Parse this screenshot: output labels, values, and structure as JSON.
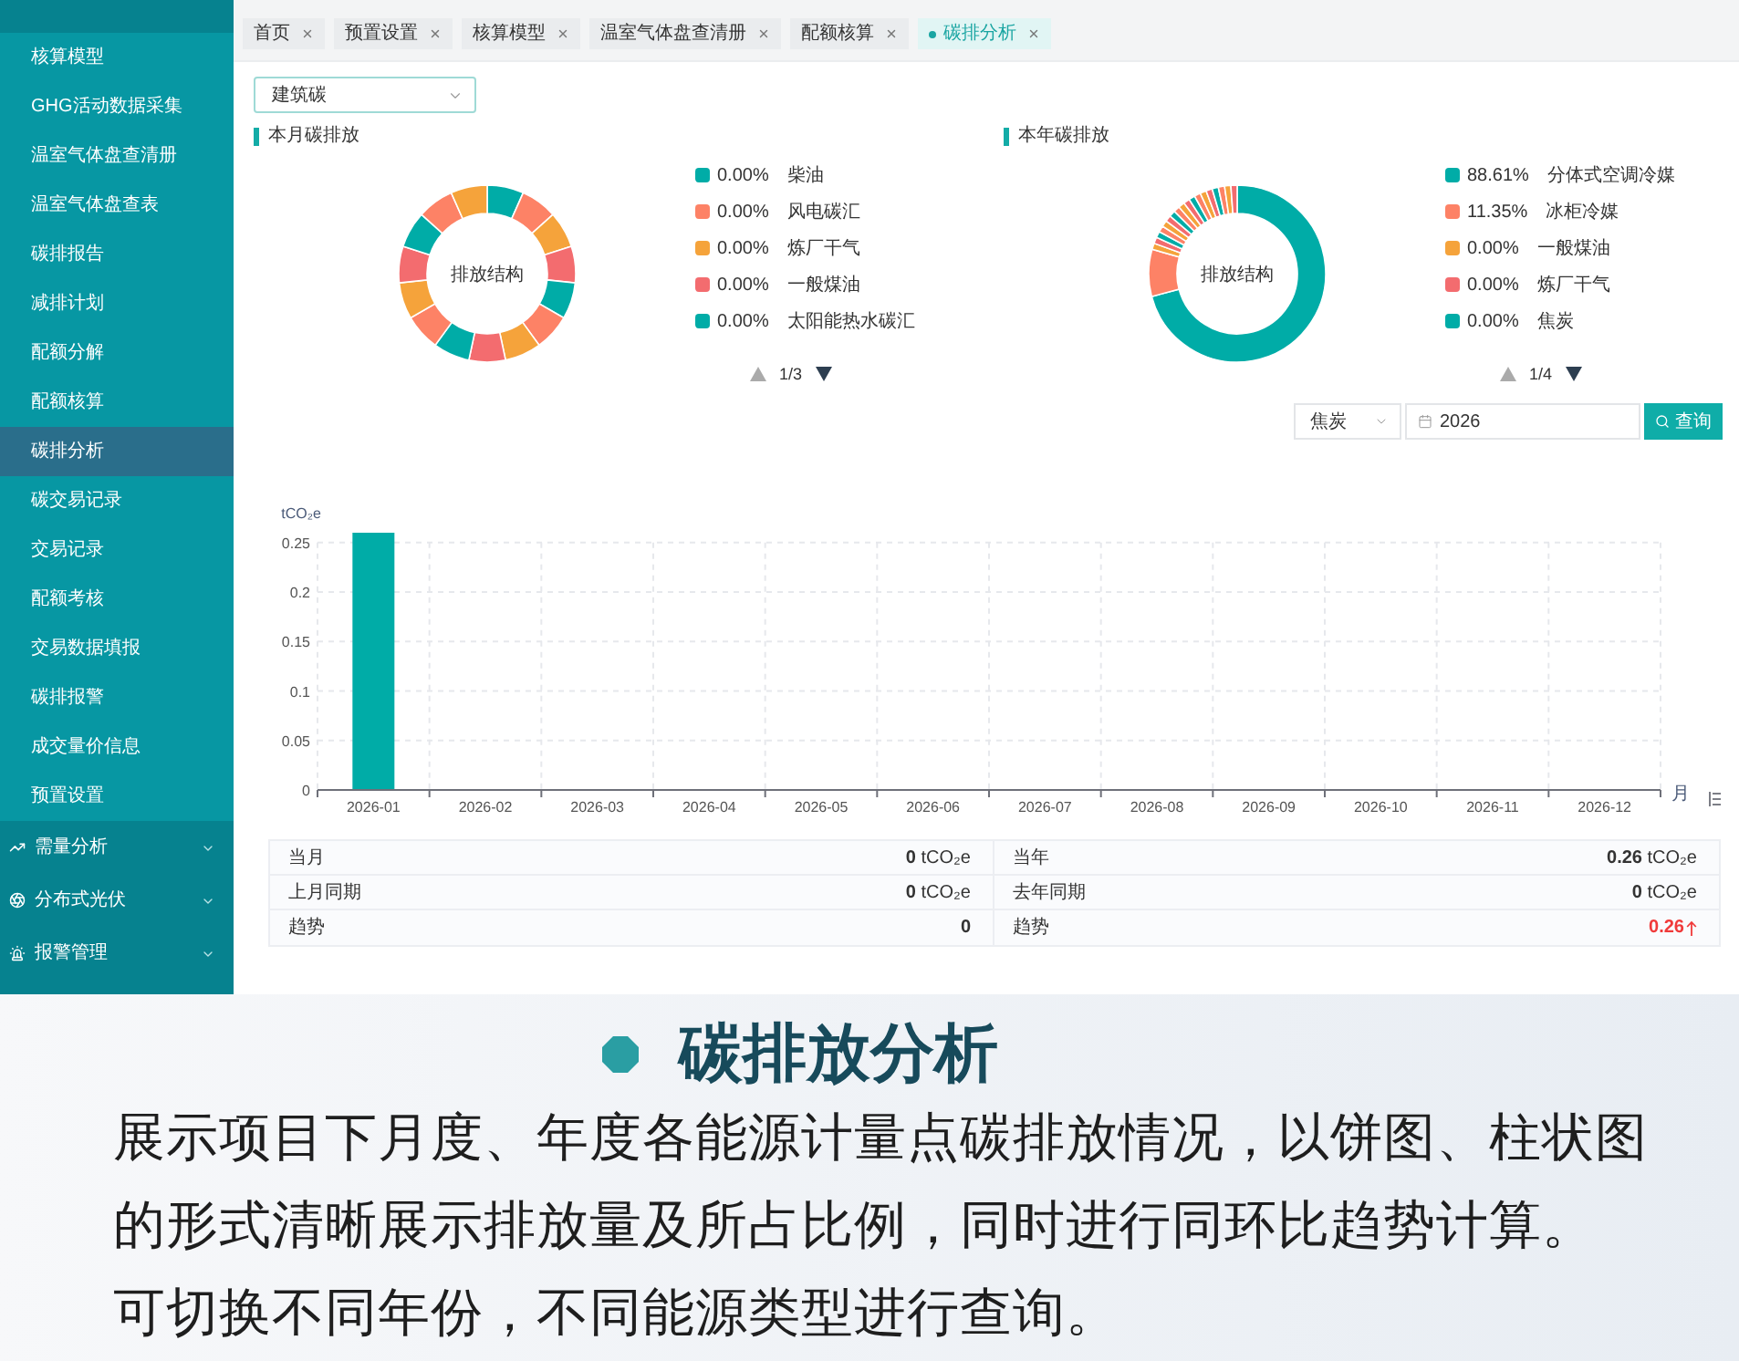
{
  "sidebar": {
    "items": [
      {
        "label": "核算模型",
        "selected": false
      },
      {
        "label": "GHG活动数据采集",
        "selected": false
      },
      {
        "label": "温室气体盘查清册",
        "selected": false
      },
      {
        "label": "温室气体盘查表",
        "selected": false
      },
      {
        "label": "碳排报告",
        "selected": false
      },
      {
        "label": "减排计划",
        "selected": false
      },
      {
        "label": "配额分解",
        "selected": false
      },
      {
        "label": "配额核算",
        "selected": false
      },
      {
        "label": "碳排分析",
        "selected": true
      },
      {
        "label": "碳交易记录",
        "selected": false
      },
      {
        "label": "交易记录",
        "selected": false
      },
      {
        "label": "配额考核",
        "selected": false
      },
      {
        "label": "交易数据填报",
        "selected": false
      },
      {
        "label": "碳排报警",
        "selected": false
      },
      {
        "label": "成交量价信息",
        "selected": false
      },
      {
        "label": "预置设置",
        "selected": false
      }
    ],
    "groups": [
      {
        "label": "需量分析",
        "expanded": false
      },
      {
        "label": "分布式光伏",
        "expanded": false
      },
      {
        "label": "报警管理",
        "expanded": false
      }
    ]
  },
  "tabs": [
    {
      "label": "首页",
      "selected": false
    },
    {
      "label": "预置设置",
      "selected": false
    },
    {
      "label": "核算模型",
      "selected": false
    },
    {
      "label": "温室气体盘查清册",
      "selected": false
    },
    {
      "label": "配额核算",
      "selected": false
    },
    {
      "label": "碳排分析",
      "selected": true
    }
  ],
  "filter": {
    "value": "建筑碳"
  },
  "monthly": {
    "title": "本月碳排放",
    "center_label": "排放结构",
    "legend": [
      {
        "percent": "0.00%",
        "name": "柴油",
        "color": "#00aca7"
      },
      {
        "percent": "0.00%",
        "name": "风电碳汇",
        "color": "#fd8266"
      },
      {
        "percent": "0.00%",
        "name": "炼厂干气",
        "color": "#f5a33b"
      },
      {
        "percent": "0.00%",
        "name": "一般煤油",
        "color": "#f36c6f"
      },
      {
        "percent": "0.00%",
        "name": "太阳能热水碳汇",
        "color": "#00aca7"
      }
    ],
    "pager": {
      "page": "1/3",
      "prev_disabled": true,
      "next_disabled": false
    }
  },
  "yearly": {
    "title": "本年碳排放",
    "center_label": "排放结构",
    "legend": [
      {
        "percent": "88.61%",
        "name": "分体式空调冷媒",
        "color": "#00aca7"
      },
      {
        "percent": "11.35%",
        "name": "冰柜冷媒",
        "color": "#fd8266"
      },
      {
        "percent": "0.00%",
        "name": "一般煤油",
        "color": "#f5a33b"
      },
      {
        "percent": "0.00%",
        "name": "炼厂干气",
        "color": "#f36c6f"
      },
      {
        "percent": "0.00%",
        "name": "焦炭",
        "color": "#00aca7"
      }
    ],
    "pager": {
      "page": "1/4",
      "prev_disabled": true,
      "next_disabled": false
    }
  },
  "query": {
    "energy_type": "焦炭",
    "year": "2026",
    "button": "查询"
  },
  "trend_chart": {
    "chart_data": {
      "type": "bar",
      "xlabel": "月",
      "ylabel": "tCO₂e",
      "categories": [
        "2026-01",
        "2026-02",
        "2026-03",
        "2026-04",
        "2026-05",
        "2026-06",
        "2026-07",
        "2026-08",
        "2026-09",
        "2026-10",
        "2026-11",
        "2026-12"
      ],
      "values": [
        0.26,
        0,
        0,
        0,
        0,
        0,
        0,
        0,
        0,
        0,
        0,
        0
      ],
      "ylim": [
        0,
        0.26
      ],
      "yticks": [
        0,
        0.05,
        0.1,
        0.15,
        0.2,
        0.25
      ],
      "grid": true
    }
  },
  "summary": {
    "left": [
      {
        "label": "当月",
        "value": "0",
        "unit": "tCO₂e"
      },
      {
        "label": "上月同期",
        "value": "0",
        "unit": "tCO₂e"
      },
      {
        "label": "趋势",
        "value": "0",
        "rising": false
      }
    ],
    "right": [
      {
        "label": "当年",
        "value": "0.26",
        "unit": "tCO₂e"
      },
      {
        "label": "去年同期",
        "value": "0",
        "unit": "tCO₂e"
      },
      {
        "label": "趋势",
        "value": "0.26",
        "rising": true
      }
    ]
  },
  "intro": {
    "title": "碳排放分析",
    "paragraphs": [
      "展示项目下月度、年度各能源计量点碳排放情况，以饼图、柱状图的形式清晰展示排放量及所占比例，同时进行同环比趋势计算。",
      "可切换不同年份，不同能源类型进行查询。"
    ]
  }
}
